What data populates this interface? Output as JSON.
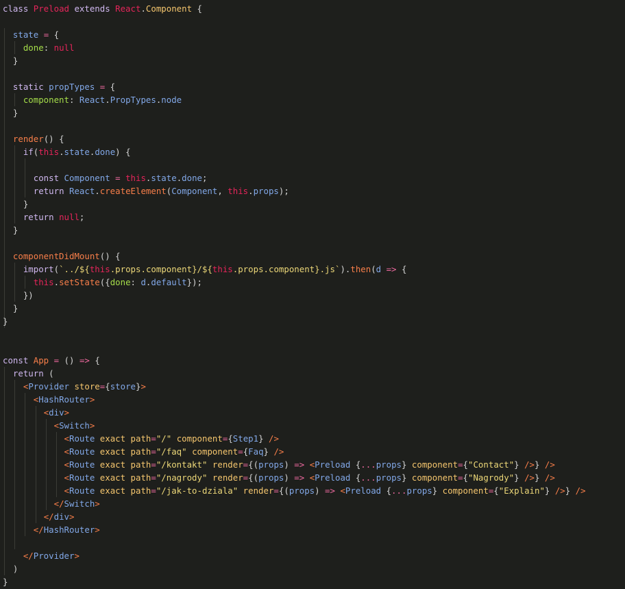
{
  "theme": {
    "background": "#1e1f1c",
    "colors": {
      "p": "#d4d4d4",
      "kw": "#d0b8f0",
      "cls": "#e5255a",
      "type": "#f5c66e",
      "var": "#a6de4a",
      "prop": "#82a8e8",
      "op": "#f06aa0",
      "null": "#e5255a",
      "this": "#e5255a",
      "fn": "#f97f4a",
      "str": "#ecd778",
      "tag": "#82a8e8",
      "ang": "#f97f4a",
      "attr": "#f5c66e",
      "param": "#82a8e8"
    }
  },
  "code_lines": [
    [
      [
        "kw",
        "class "
      ],
      [
        "cls",
        "Preload"
      ],
      [
        "kw",
        " extends "
      ],
      [
        "cls",
        "React"
      ],
      [
        "p",
        "."
      ],
      [
        "type",
        "Component"
      ],
      [
        "p",
        " {"
      ]
    ],
    [],
    [
      [
        "p",
        "  "
      ],
      [
        "prop",
        "state"
      ],
      [
        "op",
        " = "
      ],
      [
        "p",
        "{"
      ]
    ],
    [
      [
        "p",
        "    "
      ],
      [
        "var",
        "done"
      ],
      [
        "p",
        ": "
      ],
      [
        "null",
        "null"
      ]
    ],
    [
      [
        "p",
        "  }"
      ]
    ],
    [],
    [
      [
        "p",
        "  "
      ],
      [
        "kw",
        "static "
      ],
      [
        "prop",
        "propTypes"
      ],
      [
        "op",
        " = "
      ],
      [
        "p",
        "{"
      ]
    ],
    [
      [
        "p",
        "    "
      ],
      [
        "var",
        "component"
      ],
      [
        "p",
        ": "
      ],
      [
        "prop",
        "React"
      ],
      [
        "p",
        "."
      ],
      [
        "prop",
        "PropTypes"
      ],
      [
        "p",
        "."
      ],
      [
        "prop",
        "node"
      ]
    ],
    [
      [
        "p",
        "  }"
      ]
    ],
    [],
    [
      [
        "p",
        "  "
      ],
      [
        "fn",
        "render"
      ],
      [
        "p",
        "() {"
      ]
    ],
    [
      [
        "p",
        "    "
      ],
      [
        "kw",
        "if"
      ],
      [
        "p",
        "("
      ],
      [
        "this",
        "this"
      ],
      [
        "p",
        "."
      ],
      [
        "prop",
        "state"
      ],
      [
        "p",
        "."
      ],
      [
        "prop",
        "done"
      ],
      [
        "p",
        ") {"
      ]
    ],
    [],
    [
      [
        "p",
        "      "
      ],
      [
        "kw",
        "const "
      ],
      [
        "prop",
        "Component"
      ],
      [
        "op",
        " = "
      ],
      [
        "this",
        "this"
      ],
      [
        "p",
        "."
      ],
      [
        "prop",
        "state"
      ],
      [
        "p",
        "."
      ],
      [
        "prop",
        "done"
      ],
      [
        "p",
        ";"
      ]
    ],
    [
      [
        "p",
        "      "
      ],
      [
        "kw",
        "return "
      ],
      [
        "prop",
        "React"
      ],
      [
        "p",
        "."
      ],
      [
        "fn",
        "createElement"
      ],
      [
        "p",
        "("
      ],
      [
        "prop",
        "Component"
      ],
      [
        "p",
        ", "
      ],
      [
        "this",
        "this"
      ],
      [
        "p",
        "."
      ],
      [
        "prop",
        "props"
      ],
      [
        "p",
        ");"
      ]
    ],
    [
      [
        "p",
        "    }"
      ]
    ],
    [
      [
        "p",
        "    "
      ],
      [
        "kw",
        "return "
      ],
      [
        "null",
        "null"
      ],
      [
        "p",
        ";"
      ]
    ],
    [
      [
        "p",
        "  }"
      ]
    ],
    [],
    [
      [
        "p",
        "  "
      ],
      [
        "fn",
        "componentDidMount"
      ],
      [
        "p",
        "() {"
      ]
    ],
    [
      [
        "p",
        "    "
      ],
      [
        "kw",
        "import"
      ],
      [
        "p",
        "("
      ],
      [
        "str",
        "`../${"
      ],
      [
        "this",
        "this"
      ],
      [
        "str",
        "."
      ],
      [
        "str",
        "props"
      ],
      [
        "str",
        "."
      ],
      [
        "str",
        "component"
      ],
      [
        "str",
        "}/${"
      ],
      [
        "this",
        "this"
      ],
      [
        "str",
        ".props.component"
      ],
      [
        "str",
        "}.js`"
      ],
      [
        "p",
        ")."
      ],
      [
        "fn",
        "then"
      ],
      [
        "p",
        "("
      ],
      [
        "param",
        "d"
      ],
      [
        "op",
        " => "
      ],
      [
        "p",
        "{"
      ]
    ],
    [
      [
        "p",
        "      "
      ],
      [
        "this",
        "this"
      ],
      [
        "p",
        "."
      ],
      [
        "fn",
        "setState"
      ],
      [
        "p",
        "({"
      ],
      [
        "var",
        "done"
      ],
      [
        "p",
        ": "
      ],
      [
        "prop",
        "d"
      ],
      [
        "p",
        "."
      ],
      [
        "prop",
        "default"
      ],
      [
        "p",
        "});"
      ]
    ],
    [
      [
        "p",
        "    })"
      ]
    ],
    [
      [
        "p",
        "  }"
      ]
    ],
    [
      [
        "p",
        "}"
      ]
    ],
    [],
    [],
    [
      [
        "kw",
        "const "
      ],
      [
        "fn",
        "App"
      ],
      [
        "op",
        " = "
      ],
      [
        "p",
        "() "
      ],
      [
        "op",
        "=>"
      ],
      [
        "p",
        " {"
      ]
    ],
    [
      [
        "p",
        "  "
      ],
      [
        "kw",
        "return "
      ],
      [
        "p",
        "("
      ]
    ],
    [
      [
        "p",
        "    "
      ],
      [
        "ang",
        "<"
      ],
      [
        "tag",
        "Provider"
      ],
      [
        "attr",
        " store"
      ],
      [
        "op",
        "="
      ],
      [
        "p",
        "{"
      ],
      [
        "prop",
        "store"
      ],
      [
        "p",
        "}"
      ],
      [
        "ang",
        ">"
      ]
    ],
    [
      [
        "p",
        "      "
      ],
      [
        "ang",
        "<"
      ],
      [
        "tag",
        "HashRouter"
      ],
      [
        "ang",
        ">"
      ]
    ],
    [
      [
        "p",
        "        "
      ],
      [
        "ang",
        "<"
      ],
      [
        "tag",
        "div"
      ],
      [
        "ang",
        ">"
      ]
    ],
    [
      [
        "p",
        "          "
      ],
      [
        "ang",
        "<"
      ],
      [
        "tag",
        "Switch"
      ],
      [
        "ang",
        ">"
      ]
    ],
    [
      [
        "p",
        "            "
      ],
      [
        "ang",
        "<"
      ],
      [
        "tag",
        "Route"
      ],
      [
        "attr",
        " exact path"
      ],
      [
        "op",
        "="
      ],
      [
        "str",
        "\"/\""
      ],
      [
        "attr",
        " component"
      ],
      [
        "op",
        "="
      ],
      [
        "p",
        "{"
      ],
      [
        "prop",
        "Step1"
      ],
      [
        "p",
        "} "
      ],
      [
        "ang",
        "/>"
      ]
    ],
    [
      [
        "p",
        "            "
      ],
      [
        "ang",
        "<"
      ],
      [
        "tag",
        "Route"
      ],
      [
        "attr",
        " exact path"
      ],
      [
        "op",
        "="
      ],
      [
        "str",
        "\"/faq\""
      ],
      [
        "attr",
        " component"
      ],
      [
        "op",
        "="
      ],
      [
        "p",
        "{"
      ],
      [
        "prop",
        "Faq"
      ],
      [
        "p",
        "} "
      ],
      [
        "ang",
        "/>"
      ]
    ],
    [
      [
        "p",
        "            "
      ],
      [
        "ang",
        "<"
      ],
      [
        "tag",
        "Route"
      ],
      [
        "attr",
        " exact path"
      ],
      [
        "op",
        "="
      ],
      [
        "str",
        "\"/kontakt\""
      ],
      [
        "attr",
        " render"
      ],
      [
        "op",
        "="
      ],
      [
        "p",
        "{("
      ],
      [
        "param",
        "props"
      ],
      [
        "p",
        ") "
      ],
      [
        "op",
        "=>"
      ],
      [
        "p",
        " "
      ],
      [
        "ang",
        "<"
      ],
      [
        "tag",
        "Preload"
      ],
      [
        "p",
        " {"
      ],
      [
        "op",
        "..."
      ],
      [
        "prop",
        "props"
      ],
      [
        "p",
        "}"
      ],
      [
        "attr",
        " component"
      ],
      [
        "op",
        "="
      ],
      [
        "p",
        "{"
      ],
      [
        "str",
        "\"Contact\""
      ],
      [
        "p",
        "} "
      ],
      [
        "ang",
        "/>"
      ],
      [
        "p",
        "} "
      ],
      [
        "ang",
        "/>"
      ]
    ],
    [
      [
        "p",
        "            "
      ],
      [
        "ang",
        "<"
      ],
      [
        "tag",
        "Route"
      ],
      [
        "attr",
        " exact path"
      ],
      [
        "op",
        "="
      ],
      [
        "str",
        "\"/nagrody\""
      ],
      [
        "attr",
        " render"
      ],
      [
        "op",
        "="
      ],
      [
        "p",
        "{("
      ],
      [
        "param",
        "props"
      ],
      [
        "p",
        ") "
      ],
      [
        "op",
        "=>"
      ],
      [
        "p",
        " "
      ],
      [
        "ang",
        "<"
      ],
      [
        "tag",
        "Preload"
      ],
      [
        "p",
        " {"
      ],
      [
        "op",
        "..."
      ],
      [
        "prop",
        "props"
      ],
      [
        "p",
        "}"
      ],
      [
        "attr",
        " component"
      ],
      [
        "op",
        "="
      ],
      [
        "p",
        "{"
      ],
      [
        "str",
        "\"Nagrody\""
      ],
      [
        "p",
        "} "
      ],
      [
        "ang",
        "/>"
      ],
      [
        "p",
        "} "
      ],
      [
        "ang",
        "/>"
      ]
    ],
    [
      [
        "p",
        "            "
      ],
      [
        "ang",
        "<"
      ],
      [
        "tag",
        "Route"
      ],
      [
        "attr",
        " exact path"
      ],
      [
        "op",
        "="
      ],
      [
        "str",
        "\"/jak-to-dziala\""
      ],
      [
        "attr",
        " render"
      ],
      [
        "op",
        "="
      ],
      [
        "p",
        "{("
      ],
      [
        "param",
        "props"
      ],
      [
        "p",
        ") "
      ],
      [
        "op",
        "=>"
      ],
      [
        "p",
        " "
      ],
      [
        "ang",
        "<"
      ],
      [
        "tag",
        "Preload"
      ],
      [
        "p",
        " {"
      ],
      [
        "op",
        "..."
      ],
      [
        "prop",
        "props"
      ],
      [
        "p",
        "}"
      ],
      [
        "attr",
        " component"
      ],
      [
        "op",
        "="
      ],
      [
        "p",
        "{"
      ],
      [
        "str",
        "\"Explain\""
      ],
      [
        "p",
        "} "
      ],
      [
        "ang",
        "/>"
      ],
      [
        "p",
        "} "
      ],
      [
        "ang",
        "/>"
      ]
    ],
    [
      [
        "p",
        "          "
      ],
      [
        "ang",
        "</"
      ],
      [
        "tag",
        "Switch"
      ],
      [
        "ang",
        ">"
      ]
    ],
    [
      [
        "p",
        "        "
      ],
      [
        "ang",
        "</"
      ],
      [
        "tag",
        "div"
      ],
      [
        "ang",
        ">"
      ]
    ],
    [
      [
        "p",
        "      "
      ],
      [
        "ang",
        "</"
      ],
      [
        "tag",
        "HashRouter"
      ],
      [
        "ang",
        ">"
      ]
    ],
    [],
    [
      [
        "p",
        "    "
      ],
      [
        "ang",
        "</"
      ],
      [
        "tag",
        "Provider"
      ],
      [
        "ang",
        ">"
      ]
    ],
    [
      [
        "p",
        "  )"
      ]
    ],
    [
      [
        "p",
        "}"
      ]
    ]
  ]
}
